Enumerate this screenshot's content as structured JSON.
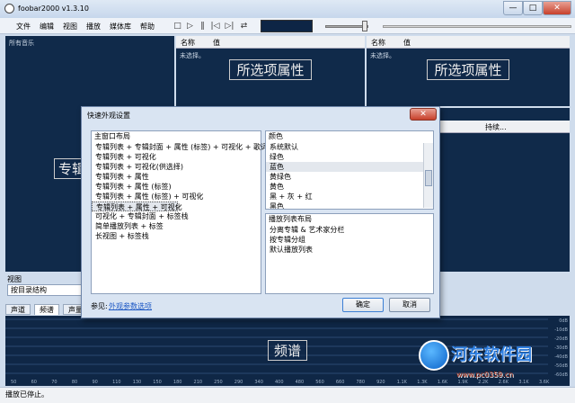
{
  "window": {
    "title": "foobar2000 v1.3.10",
    "min": "—",
    "max": "□",
    "close": "✕"
  },
  "menu": [
    "文件",
    "编辑",
    "视图",
    "播放",
    "媒体库",
    "帮助"
  ],
  "toolbar_icons": [
    "stop-icon",
    "play-icon",
    "pause-icon",
    "previous-icon",
    "next-icon",
    "random-icon"
  ],
  "toolbar_glyphs": [
    "□",
    "▷",
    "‖",
    "|◁",
    "▷|",
    "⇄"
  ],
  "library": {
    "header": "所有音乐",
    "placeholder": "专辑"
  },
  "props_left": {
    "col_name": "名称",
    "col_value": "值",
    "empty": "未选择。",
    "placeholder": "所选项属性"
  },
  "props_right": {
    "col_name": "名称",
    "col_value": "值",
    "empty": "未选择。",
    "placeholder": "所选项属性",
    "col_extra": "持续..."
  },
  "view_panel": {
    "label": "视图",
    "value": "按目录结构"
  },
  "dialog": {
    "title": "快速外观设置",
    "close": "✕",
    "layout_header": "主窗口布局",
    "layouts": [
      "专辑列表 + 专辑封面 + 属性 (标签) + 可视化 + 歌词",
      "专辑列表 + 可视化",
      "专辑列表 + 可视化(供选择)",
      "专辑列表 + 属性",
      "专辑列表 + 属性 (标签)",
      "专辑列表 + 属性 (标签) + 可视化",
      "专辑列表 + 属性 + 可视化",
      "可视化 + 专辑封面 + 标签栈",
      "简单播放列表 + 标签",
      "长视图 + 标签栈"
    ],
    "color_header": "颜色",
    "colors": [
      "系统默认",
      "绿色",
      "蓝色",
      "黄绿色",
      "黄色",
      "黑 + 灰 + 红",
      "黑色"
    ],
    "playlist_header": "播放列表布局",
    "playlists": [
      "分离专辑 & 艺术家分栏",
      "按专辑分组",
      "默认播放列表"
    ],
    "see_also_label": "参见:",
    "see_also_link": "外观参数选项",
    "ok": "确定",
    "cancel": "取消"
  },
  "tabs": [
    "声道",
    "频谱",
    "声量表"
  ],
  "spectrum": {
    "placeholder": "频谱",
    "x_ticks": [
      "50",
      "60",
      "70",
      "80",
      "90",
      "110",
      "130",
      "150",
      "180",
      "210",
      "250",
      "290",
      "340",
      "400",
      "480",
      "560",
      "660",
      "780",
      "920",
      "1.1K",
      "1.3K",
      "1.6K",
      "1.9K",
      "2.2K",
      "2.6K",
      "3.1K",
      "3.6K"
    ],
    "y_ticks": [
      "0dB",
      "-10dB",
      "-20dB",
      "-30dB",
      "-40dB",
      "-50dB",
      "-60dB"
    ]
  },
  "watermark": {
    "brand": "河东软件园",
    "url": "www.pc0359.cn"
  },
  "status": "播放已停止。",
  "colors": {
    "panel_dark": "#102a4a",
    "chrome": "#cfdcec",
    "link": "#1a56c4"
  }
}
